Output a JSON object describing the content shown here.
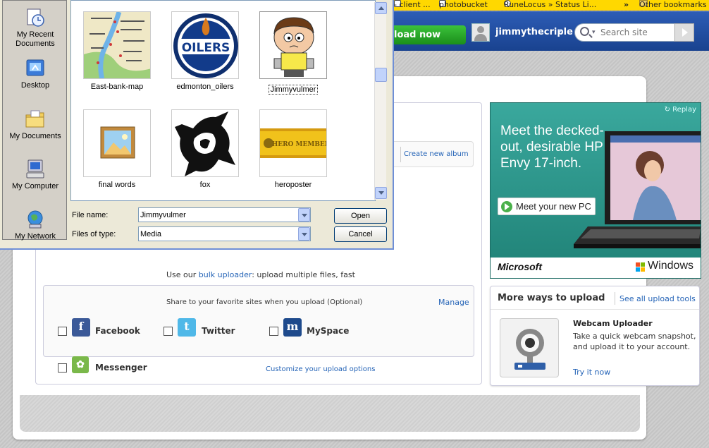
{
  "bookmarks": [
    {
      "label": "- client ...",
      "icon": "bookmark-icon"
    },
    {
      "label": "photobucket",
      "icon": "photobucket-icon"
    },
    {
      "label": "RuneLocus » Status Li...",
      "icon": "runelocus-icon"
    },
    {
      "label": "»",
      "icon": "overflow-chevron"
    },
    {
      "label": "Other bookmarks",
      "icon": "folder-icon"
    }
  ],
  "header": {
    "upload_now": "load now",
    "username": "jimmythecriple",
    "search_placeholder": "Search site"
  },
  "album": {
    "create_label": "Create new album"
  },
  "bulk": {
    "prefix": "Use our ",
    "link": "bulk uploader",
    "suffix": ": upload multiple files, fast"
  },
  "share": {
    "title": "Share to your favorite sites when you upload (Optional)",
    "manage": "Manage",
    "services": [
      {
        "name": "Facebook",
        "color": "#3b5998",
        "glyph": "f"
      },
      {
        "name": "Twitter",
        "color": "#4fb8e8",
        "glyph": "t"
      },
      {
        "name": "MySpace",
        "color": "#1e4a8c",
        "glyph": "m"
      },
      {
        "name": "Messenger",
        "color": "#7ab84a",
        "glyph": "✿"
      }
    ],
    "customize": "Customize your upload options"
  },
  "ad": {
    "replay": "Replay",
    "headline": "Meet the decked-out, desirable HP Envy 17-inch.",
    "cta": "Meet your new PC",
    "brand_left": "Microsoft",
    "brand_right": "Windows",
    "bg_color": "#2d9a91"
  },
  "more_ways": {
    "title": "More ways to upload",
    "see_all": "See all upload tools",
    "webcam_title": "Webcam Uploader",
    "webcam_desc": "Take a quick webcam snapshot, and upload it to your account.",
    "try_it": "Try it now"
  },
  "dialog": {
    "places": [
      "My Recent Documents",
      "Desktop",
      "My Documents",
      "My Computer",
      "My Network"
    ],
    "files": [
      {
        "name": "East-bank-map",
        "kind": "map"
      },
      {
        "name": "edmonton_oilers",
        "kind": "oilers-logo"
      },
      {
        "name": "Jimmyvulmer",
        "kind": "cartoon",
        "selected": true
      },
      {
        "name": "final words",
        "kind": "image-placeholder"
      },
      {
        "name": "fox",
        "kind": "fox-emblem"
      },
      {
        "name": "heroposter",
        "kind": "hero-banner"
      }
    ],
    "hero_banner_text": "HERO MEMBER",
    "oilers_text": "OILERS",
    "file_name_label": "File name:",
    "file_name_value": "Jimmyvulmer",
    "file_type_label": "Files of type:",
    "file_type_value": "Media",
    "open": "Open",
    "cancel": "Cancel"
  }
}
